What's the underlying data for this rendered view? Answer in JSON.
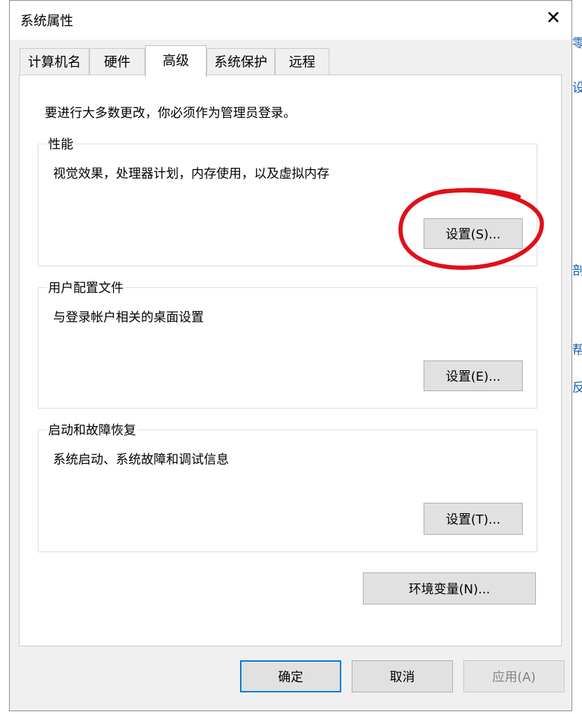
{
  "window": {
    "title": "系统属性",
    "close_glyph": "✕"
  },
  "tabs": [
    {
      "label": "计算机名"
    },
    {
      "label": "硬件"
    },
    {
      "label": "高级"
    },
    {
      "label": "系统保护"
    },
    {
      "label": "远程"
    }
  ],
  "active_tab": "高级",
  "notice": "要进行大多数更改，你必须作为管理员登录。",
  "groups": {
    "performance": {
      "label": "性能",
      "description": "视觉效果，处理器计划，内存使用，以及虚拟内存",
      "button": "设置(S)..."
    },
    "user_profiles": {
      "label": "用户配置文件",
      "description": "与登录帐户相关的桌面设置",
      "button": "设置(E)..."
    },
    "startup_recovery": {
      "label": "启动和故障恢复",
      "description": "系统启动、系统故障和调试信息",
      "button": "设置(T)..."
    }
  },
  "env_button": "环境变量(N)...",
  "footer": {
    "ok": "确定",
    "cancel": "取消",
    "apply": "应用(A)"
  },
  "background_glyphs": [
    "零",
    "设",
    "剖",
    "帮",
    "反"
  ],
  "colors": {
    "accent": "#0078d7",
    "highlight_ring": "#e0101a"
  }
}
